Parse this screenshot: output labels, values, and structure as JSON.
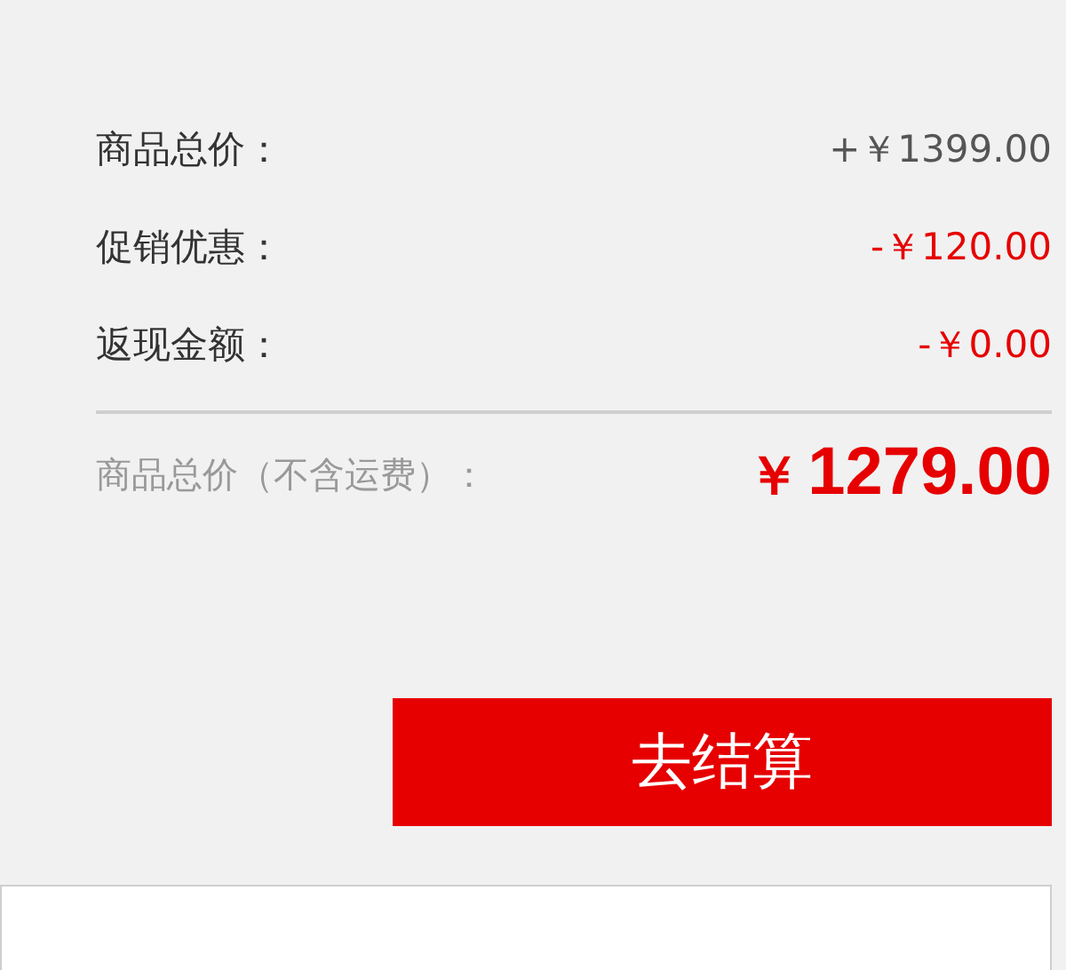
{
  "summary": [
    {
      "label": "商品总价：",
      "value": "+￥1399.00",
      "color": "#555555"
    },
    {
      "label": "促销优惠：",
      "value": "-￥120.00",
      "color": "#e60000"
    },
    {
      "label": "返现金额：",
      "value": "-￥0.00",
      "color": "#e60000"
    }
  ],
  "total": {
    "label": "商品总价（不含运费）：",
    "currency": "￥",
    "amount": "1279.00"
  },
  "checkout_button": "去结算"
}
